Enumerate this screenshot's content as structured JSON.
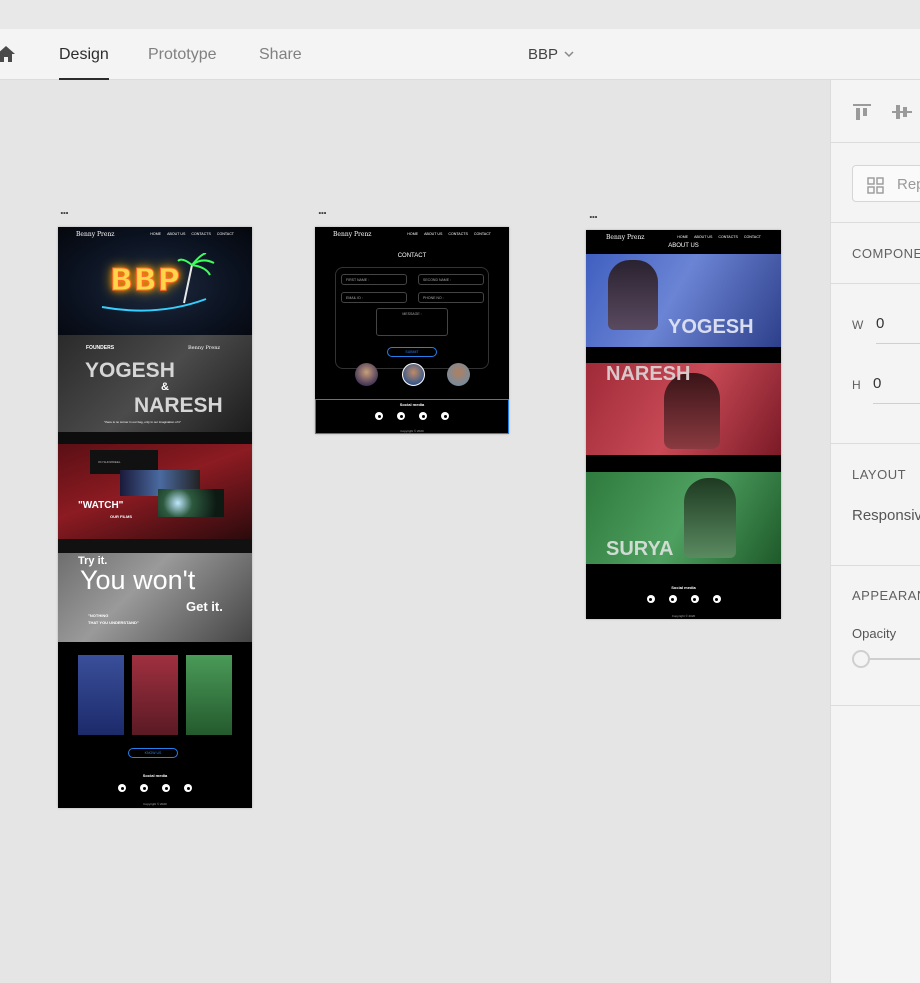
{
  "toolbar": {
    "tabs": [
      {
        "label": "Design"
      },
      {
        "label": "Prototype"
      },
      {
        "label": "Share"
      }
    ],
    "document_title": "BBP"
  },
  "artboards": {
    "menu_label": "...",
    "home": {
      "nav": {
        "logo": "Benny Prenz",
        "links": [
          "HOME",
          "ABOUT US",
          "CONTACTS",
          "CONTACT"
        ]
      },
      "hero_sign": "BBP",
      "founders": {
        "label": "FOUNDERS",
        "name1": "YOGESH",
        "amp": "&",
        "name2": "NARESH",
        "logo": "Benny Prenz",
        "quote": "\"there is no corner in our bag, only in our imagination of it\""
      },
      "watch": {
        "small_label": "ON SHOWREEL",
        "title": "\"WATCH\"",
        "subtitle": "OUR FILMS"
      },
      "tryit": {
        "line1": "Try it.",
        "line2": "You won't",
        "line3": "Get it.",
        "quote1": "\"NOTHING",
        "quote2": "THAT YOU UNDERSTAND\""
      },
      "team_button": "KNOW US",
      "social_label": "Social media",
      "copyright": "Copyright © 2020"
    },
    "contact": {
      "nav": {
        "logo": "Benny Prenz",
        "links": [
          "HOME",
          "ABOUT US",
          "CONTACTS",
          "CONTACT"
        ]
      },
      "heading": "CONTACT",
      "fields": [
        "FIRST NAME :",
        "SECOND NAME :",
        "EMAIL ID :",
        "PHONE NO :"
      ],
      "message": "MESSAGE :",
      "submit": "SUBMIT",
      "social_label": "Social media",
      "copyright": "Copyright © 2020"
    },
    "about": {
      "nav": {
        "logo": "Benny Prenz",
        "links": [
          "HOME",
          "ABOUT US",
          "CONTACTS",
          "CONTACT"
        ]
      },
      "heading": "ABOUT US",
      "members": [
        {
          "name": "YOGESH"
        },
        {
          "name": "NARESH"
        },
        {
          "name": "SURYA"
        }
      ],
      "social_label": "Social media",
      "copyright": "Copyright © 2020"
    }
  },
  "panel": {
    "repeat_grid": "Rep",
    "component_label": "COMPONE",
    "w_label": "W",
    "w_value": "0",
    "h_label": "H",
    "h_value": "0",
    "layout_label": "LAYOUT",
    "responsive": "Responsive",
    "appearance_label": "APPEARAN",
    "opacity_label": "Opacity"
  },
  "colors": {
    "accent_blue": "#2680eb",
    "yogesh_tint": "#4a6ac8",
    "naresh_tint": "#b83340",
    "surya_tint": "#3c8f4e"
  }
}
